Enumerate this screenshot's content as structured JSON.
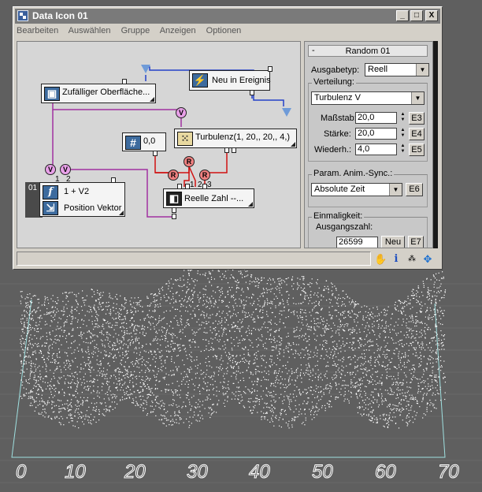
{
  "window": {
    "title": "Data Icon 01",
    "controls": [
      "_",
      "□",
      "X"
    ]
  },
  "menu": [
    "Bearbeiten",
    "Auswählen",
    "Gruppe",
    "Anzeigen",
    "Optionen"
  ],
  "nodes": {
    "surface": "Zufälliger Oberfläche...",
    "event": "Neu in Ereignis",
    "constant": "0,0",
    "turbulence": "Turbulenz(1, 20,, 20,, 4,)",
    "real": "Reelle Zahl --...",
    "func_line1": "1 + V2",
    "func_line2": "Position Vektor",
    "func_id": "01",
    "func_icon": "f",
    "const_icon": "#",
    "port_v": "V",
    "port_r": "R",
    "port_nums": [
      "1",
      "2",
      "1",
      "2",
      "3"
    ]
  },
  "panel": {
    "rollout_minus": "-",
    "rollout_title": "Random 01",
    "ausgabetyp_label": "Ausgabetyp:",
    "ausgabetyp_value": "Reell",
    "verteilung_label": "Verteilung:",
    "verteilung_value": "Turbulenz V",
    "massstab_label": "Maßstab:",
    "massstab_value": "20,0",
    "massstab_btn": "E3",
    "staerke_label": "Stärke:",
    "staerke_value": "20,0",
    "staerke_btn": "E4",
    "wiederh_label": "Wiederh.:",
    "wiederh_value": "4,0",
    "wiederh_btn": "E5",
    "sync_label": "Param. Anim.-Sync.:",
    "sync_value": "Absolute Zeit",
    "sync_btn": "E6",
    "einmaligkeit_label": "Einmaligkeit:",
    "ausgangszahl_label": "Ausgangszahl:",
    "ausgangszahl_value": "26599",
    "neu_btn": "Neu",
    "neu_e_btn": "E7"
  },
  "status_icons": [
    "hand-icon",
    "info-icon",
    "select-icon",
    "move-icon"
  ],
  "viewport": {
    "axis_labels": [
      "0",
      "10",
      "20",
      "30",
      "40",
      "50",
      "60",
      "70"
    ]
  },
  "colors": {
    "title_bar": "#7a7a7a",
    "v_port": "#e8a0e8",
    "r_port": "#ef8080",
    "wire_blue": "#2340c8",
    "wire_magenta": "#a030a0",
    "wire_red": "#d01010",
    "node_icon": "#3d6b9e"
  }
}
